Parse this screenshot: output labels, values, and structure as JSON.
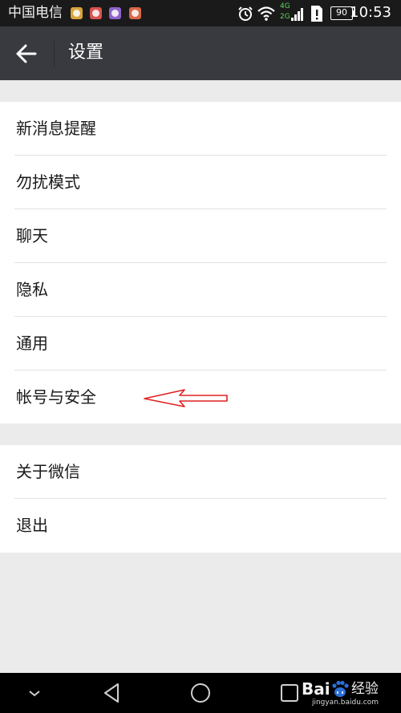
{
  "status_bar": {
    "carrier": "中国电信",
    "network_top": "4G",
    "network_bottom": "2G",
    "battery": "90",
    "time": "10:53",
    "notification_icons": [
      {
        "name": "chrome-app-icon",
        "color": "#d8a33a"
      },
      {
        "name": "health-app-icon",
        "color": "#d9534f"
      },
      {
        "name": "gallery-app-icon",
        "color": "#8e63c9"
      },
      {
        "name": "tool-app-icon",
        "color": "#d9674a"
      }
    ]
  },
  "app_bar": {
    "back_icon": "arrow-left-icon",
    "title": "设置"
  },
  "settings": {
    "group1": [
      {
        "label": "新消息提醒"
      },
      {
        "label": "勿扰模式"
      },
      {
        "label": "聊天"
      },
      {
        "label": "隐私"
      },
      {
        "label": "通用"
      },
      {
        "label": "帐号与安全"
      }
    ],
    "group2": [
      {
        "label": "关于微信"
      },
      {
        "label": "退出"
      }
    ]
  },
  "annotation": {
    "arrow_color": "#e02020",
    "target": "帐号与安全"
  },
  "nav_bar": {
    "buttons": [
      "chevron-down-icon",
      "back-triangle-icon",
      "home-circle-icon",
      "recents-square-icon"
    ]
  },
  "watermark": {
    "brand": "Bai",
    "brand_cn": "经验",
    "url": "jingyan.baidu.com"
  },
  "colors": {
    "status_bar": "#1a1a1a",
    "app_bar": "#393a3f",
    "background": "#ebebeb",
    "list_bg": "#ffffff",
    "nav_bar": "#000000"
  }
}
